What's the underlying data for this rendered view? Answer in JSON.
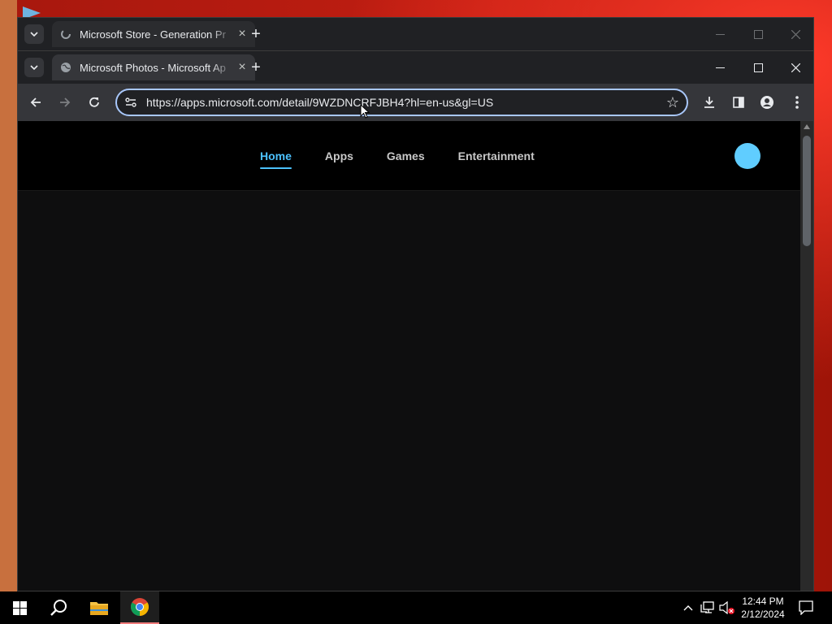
{
  "back_window": {
    "tab_title": "Microsoft Store - Generation Pr",
    "close_tab": "×",
    "new_tab": "+"
  },
  "front_window": {
    "tab_title": "Microsoft Photos - Microsoft Ap",
    "close_tab": "×",
    "new_tab": "+",
    "url": "https://apps.microsoft.com/detail/9WZDNCRFJBH4?hl=en-us&gl=US"
  },
  "site": {
    "nav": [
      {
        "label": "Home",
        "active": true
      },
      {
        "label": "Apps",
        "active": false
      },
      {
        "label": "Games",
        "active": false
      },
      {
        "label": "Entertainment",
        "active": false
      }
    ]
  },
  "taskbar": {
    "time": "12:44 PM",
    "date": "2/12/2024"
  },
  "colors": {
    "accent": "#4cc2ff",
    "avatar": "#60cdff",
    "page_bg": "#0e0e0f",
    "header_bg": "#000000"
  }
}
